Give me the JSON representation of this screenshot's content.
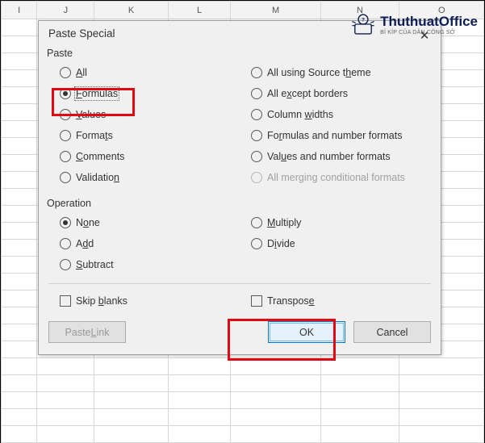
{
  "columns": [
    "I",
    "J",
    "K",
    "L",
    "M",
    "N",
    "O"
  ],
  "dialog": {
    "title": "Paste Special",
    "close_glyph": "✕",
    "paste_label": "Paste",
    "operation_label": "Operation",
    "paste_left": [
      {
        "pre": "",
        "u": "A",
        "post": "ll",
        "checked": false,
        "disabled": false
      },
      {
        "pre": "",
        "u": "F",
        "post": "ormulas",
        "checked": true,
        "disabled": false,
        "focus": true
      },
      {
        "pre": "",
        "u": "V",
        "post": "alues",
        "checked": false,
        "disabled": false
      },
      {
        "pre": "Forma",
        "u": "t",
        "post": "s",
        "checked": false,
        "disabled": false
      },
      {
        "pre": "",
        "u": "C",
        "post": "omments",
        "checked": false,
        "disabled": false
      },
      {
        "pre": "Validatio",
        "u": "n",
        "post": "",
        "checked": false,
        "disabled": false
      }
    ],
    "paste_right": [
      {
        "pre": "All using Source t",
        "u": "h",
        "post": "eme",
        "checked": false,
        "disabled": false
      },
      {
        "pre": "All e",
        "u": "x",
        "post": "cept borders",
        "checked": false,
        "disabled": false
      },
      {
        "pre": "Column ",
        "u": "w",
        "post": "idths",
        "checked": false,
        "disabled": false
      },
      {
        "pre": "Fo",
        "u": "r",
        "post": "mulas and number formats",
        "checked": false,
        "disabled": false
      },
      {
        "pre": "Val",
        "u": "u",
        "post": "es and number formats",
        "checked": false,
        "disabled": false
      },
      {
        "pre": "All mer",
        "u": "g",
        "post": "ing conditional formats",
        "checked": false,
        "disabled": true
      }
    ],
    "op_left": [
      {
        "pre": "N",
        "u": "o",
        "post": "ne",
        "checked": true,
        "disabled": false
      },
      {
        "pre": "A",
        "u": "d",
        "post": "d",
        "checked": false,
        "disabled": false
      },
      {
        "pre": "",
        "u": "S",
        "post": "ubtract",
        "checked": false,
        "disabled": false
      }
    ],
    "op_right": [
      {
        "pre": "",
        "u": "M",
        "post": "ultiply",
        "checked": false,
        "disabled": false
      },
      {
        "pre": "D",
        "u": "i",
        "post": "vide",
        "checked": false,
        "disabled": false
      }
    ],
    "skip_blanks": {
      "pre": "Skip ",
      "u": "b",
      "post": "lanks",
      "checked": false
    },
    "transpose": {
      "pre": "Transpos",
      "u": "e",
      "post": "",
      "checked": false
    },
    "paste_link": {
      "pre": "Paste ",
      "u": "L",
      "post": "ink",
      "disabled": true
    },
    "ok_label": "OK",
    "cancel_label": "Cancel"
  },
  "watermark": {
    "brand": "ThuthuatOffice",
    "sub": "BÍ KÍP CỦA DÂN CÔNG SỞ"
  }
}
